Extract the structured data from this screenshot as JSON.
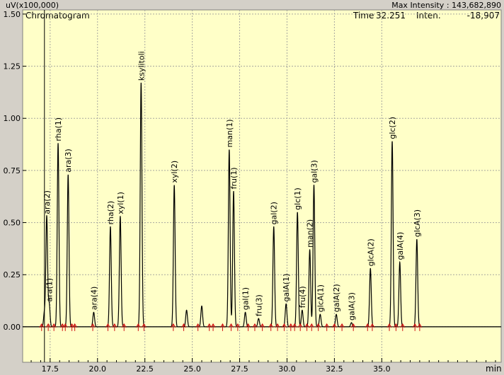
{
  "header": {
    "y_unit": "uV(x100,000)",
    "max_intensity": "Max Intensity : 143,682,890",
    "panel_title": "Chromatogram",
    "time_label": "Time",
    "time_value": "32.251",
    "inten_label": "Inten.",
    "inten_value": "-18,907"
  },
  "colors": {
    "plot_bg": "#ffffc8",
    "frame_bg": "#d4d0c8",
    "trace": "#000000",
    "marker": "#d01010"
  },
  "chart_data": {
    "type": "line",
    "xlabel": "min",
    "ylabel": "uV(x100,000)",
    "xlim": [
      16.05,
      41.3
    ],
    "ylim": [
      -0.17,
      1.52
    ],
    "xticks": [
      17.5,
      20.0,
      22.5,
      25.0,
      27.5,
      30.0,
      32.5,
      35.0
    ],
    "xtick_labels": [
      "17.5",
      "20.0",
      "22.5",
      "25.0",
      "27.5",
      "30.0",
      "32.5",
      "35.0"
    ],
    "yticks": [
      0.0,
      0.25,
      0.5,
      0.75,
      1.0,
      1.25,
      1.5
    ],
    "ytick_labels": [
      "0.00",
      "0.25",
      "0.50",
      "0.75",
      "1.00",
      "1.25",
      "1.50"
    ],
    "cursor_x": 17.2,
    "peaks": [
      {
        "t": 17.2,
        "h": 0.07,
        "label": ""
      },
      {
        "t": 17.32,
        "h": 0.53,
        "label": "ara(2)"
      },
      {
        "t": 17.45,
        "h": 0.11,
        "label": "ara(1)"
      },
      {
        "t": 17.92,
        "h": 0.88,
        "label": "rha(1)"
      },
      {
        "t": 18.45,
        "h": 0.73,
        "label": "ara(3)"
      },
      {
        "t": 19.8,
        "h": 0.07,
        "label": "ara(4)"
      },
      {
        "t": 20.68,
        "h": 0.48,
        "label": "rha(2)"
      },
      {
        "t": 21.2,
        "h": 0.53,
        "label": "xyl(1)"
      },
      {
        "t": 22.3,
        "h": 1.17,
        "label": "ksylitoli"
      },
      {
        "t": 24.05,
        "h": 0.68,
        "label": "xyl(2)"
      },
      {
        "t": 24.7,
        "h": 0.08,
        "label": ""
      },
      {
        "t": 25.5,
        "h": 0.1,
        "label": ""
      },
      {
        "t": 26.95,
        "h": 0.85,
        "label": "man(1)"
      },
      {
        "t": 27.18,
        "h": 0.65,
        "label": "fru(1)"
      },
      {
        "t": 27.8,
        "h": 0.07,
        "label": "gal(1)"
      },
      {
        "t": 28.5,
        "h": 0.04,
        "label": "fru(3)"
      },
      {
        "t": 29.3,
        "h": 0.48,
        "label": "gal(2)"
      },
      {
        "t": 29.95,
        "h": 0.11,
        "label": "galA(1)"
      },
      {
        "t": 30.55,
        "h": 0.55,
        "label": "glc(1)"
      },
      {
        "t": 30.8,
        "h": 0.08,
        "label": "fru(4)"
      },
      {
        "t": 31.2,
        "h": 0.37,
        "label": "man(2)"
      },
      {
        "t": 31.42,
        "h": 0.68,
        "label": "gal(3)"
      },
      {
        "t": 31.75,
        "h": 0.06,
        "label": "glcA(1)"
      },
      {
        "t": 32.6,
        "h": 0.06,
        "label": "galA(2)"
      },
      {
        "t": 33.4,
        "h": 0.02,
        "label": "galA(3)"
      },
      {
        "t": 34.4,
        "h": 0.28,
        "label": "glcA(2)"
      },
      {
        "t": 35.55,
        "h": 0.89,
        "label": "glc(2)"
      },
      {
        "t": 35.95,
        "h": 0.31,
        "label": "galA(4)"
      },
      {
        "t": 36.85,
        "h": 0.42,
        "label": "glcA(3)"
      }
    ],
    "markers": [
      17.05,
      17.4,
      17.7,
      18.15,
      18.3,
      18.65,
      18.8,
      19.75,
      20.55,
      20.9,
      21.4,
      22.15,
      22.45,
      24.0,
      24.55,
      25.3,
      25.9,
      26.1,
      26.6,
      27.05,
      27.4,
      27.95,
      28.3,
      28.7,
      29.15,
      29.5,
      29.85,
      30.2,
      30.4,
      30.7,
      31.05,
      31.3,
      31.65,
      32.1,
      32.5,
      32.9,
      33.5,
      34.25,
      34.5,
      35.4,
      35.75,
      36.1,
      36.75,
      37.0
    ]
  }
}
